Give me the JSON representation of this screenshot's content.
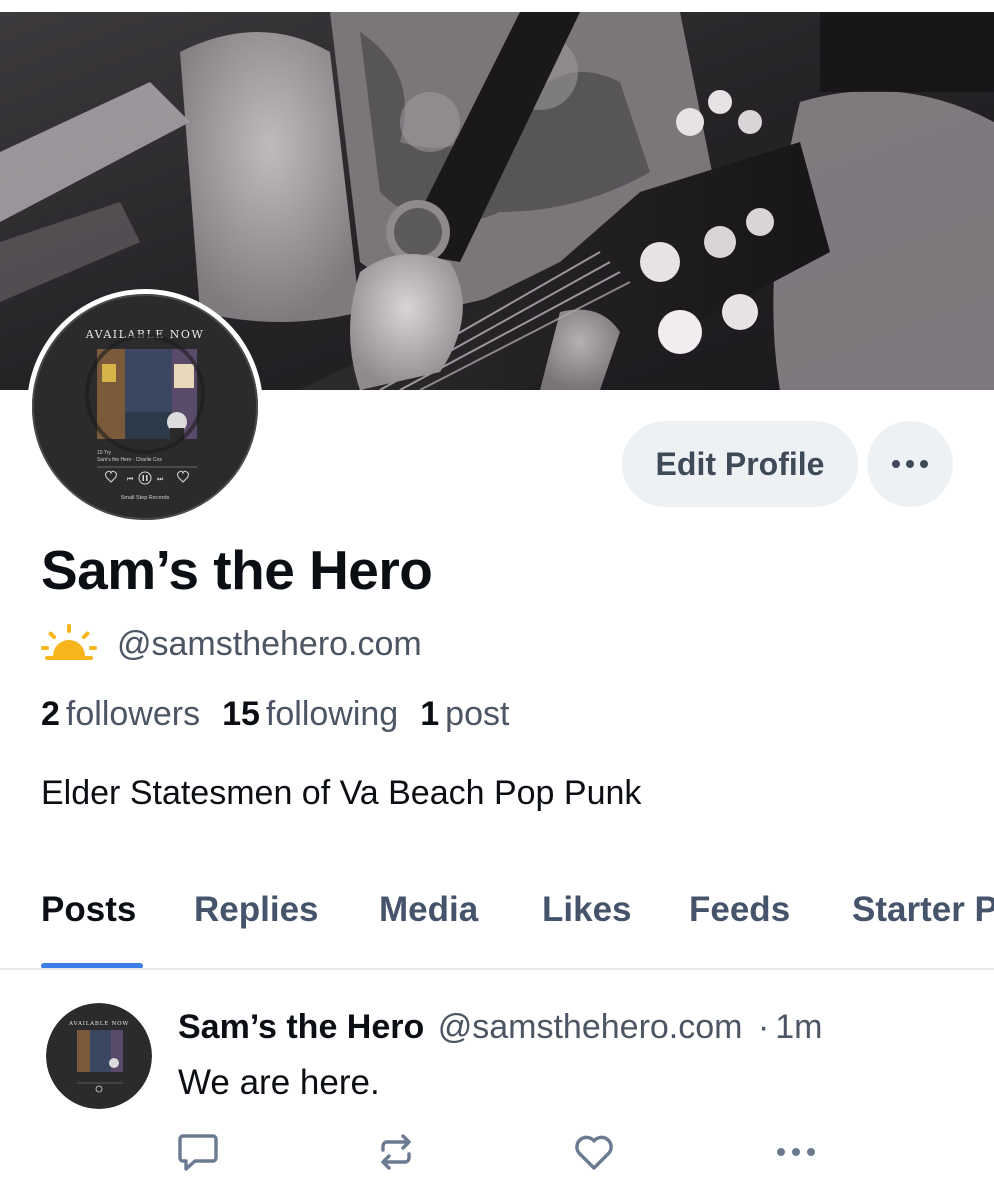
{
  "profile": {
    "display_name": "Sam’s the Hero",
    "handle": "@samsthehero.com",
    "followers_count": "2",
    "followers_label": "followers",
    "following_count": "15",
    "following_label": "following",
    "posts_count": "1",
    "posts_label": "post",
    "bio": "Elder Statesmen of Va Beach Pop Punk",
    "handle_icon": "sun-icon"
  },
  "avatar_art": {
    "top_text": "AVAILABLE NOW",
    "track_line": "10 Try",
    "artist_line": "Sam's the Hero · Charlie Cox",
    "label_text": "Small Step Records"
  },
  "actions": {
    "edit_profile_label": "Edit Profile"
  },
  "tabs": [
    {
      "label": "Posts",
      "active": true
    },
    {
      "label": "Replies",
      "active": false
    },
    {
      "label": "Media",
      "active": false
    },
    {
      "label": "Likes",
      "active": false
    },
    {
      "label": "Feeds",
      "active": false
    },
    {
      "label": "Starter Packs",
      "active": false
    }
  ],
  "post": {
    "author": "Sam’s the Hero",
    "handle": "@samsthehero.com",
    "separator": "·",
    "time": "1m",
    "text": "We are here."
  },
  "colors": {
    "accent": "#3b7ce6",
    "button_bg": "#eef1f4",
    "secondary_text": "#4b5563",
    "tab_inactive": "#45546a",
    "sun": "#f5b51b"
  }
}
